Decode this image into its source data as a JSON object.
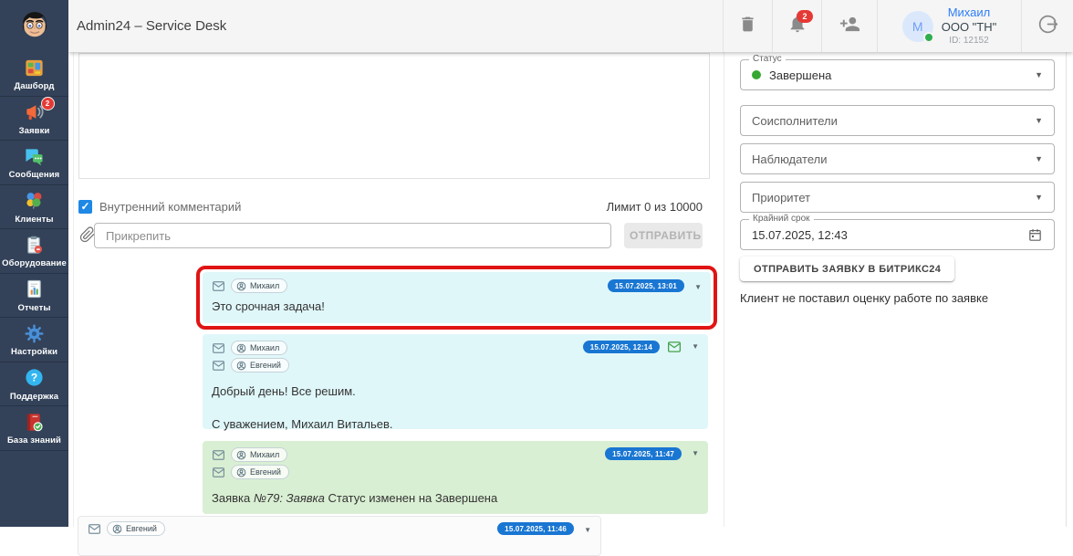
{
  "header": {
    "title": "Admin24 – Service Desk",
    "notifications_badge": "2",
    "user": {
      "name": "Михаил",
      "company": "ООО \"ТН\"",
      "id_label": "ID: 12152",
      "avatar_initial": "M"
    }
  },
  "sidebar": {
    "items": [
      {
        "label": "Дашборд"
      },
      {
        "label": "Заявки",
        "badge": "2"
      },
      {
        "label": "Сообщения"
      },
      {
        "label": "Клиенты"
      },
      {
        "label": "Оборудование"
      },
      {
        "label": "Отчеты"
      },
      {
        "label": "Настройки"
      },
      {
        "label": "Поддержка"
      },
      {
        "label": "База знаний"
      }
    ]
  },
  "composer": {
    "internal_comment_label": "Внутренний комментарий",
    "limit_label": "Лимит 0 из 10000",
    "attach_placeholder": "Прикрепить",
    "send_label": "ОТПРАВИТЬ"
  },
  "messages": [
    {
      "participants": [
        "Михаил"
      ],
      "timestamp": "15.07.2025, 13:01",
      "lines": [
        "Это срочная задача!"
      ],
      "highlighted": true
    },
    {
      "participants": [
        "Михаил",
        "Евгений"
      ],
      "timestamp": "15.07.2025, 12:14",
      "email_sent": true,
      "lines": [
        "Добрый день! Все решим.",
        "С уважением, Михаил Витальев."
      ]
    },
    {
      "participants": [
        "Михаил",
        "Евгений"
      ],
      "timestamp": "15.07.2025, 11:47",
      "text_plain": "Заявка ",
      "text_italic": "№79: Заявка ",
      "text_rest": "Статус изменен на Завершена"
    },
    {
      "participants": [
        "Евгений"
      ],
      "timestamp": "15.07.2025, 11:46"
    }
  ],
  "panel": {
    "status": {
      "label": "Статус",
      "value": "Завершена"
    },
    "fields": [
      {
        "placeholder": "Соисполнители"
      },
      {
        "placeholder": "Наблюдатели"
      },
      {
        "placeholder": "Приоритет"
      }
    ],
    "deadline": {
      "label": "Крайний срок",
      "value": "15.07.2025, 12:43"
    },
    "bitrix_button": "ОТПРАВИТЬ ЗАЯВКУ В БИТРИКС24",
    "rating_note": "Клиент не поставил оценку работе по заявке"
  },
  "colors": {
    "sidebar-bg": "#334259",
    "header-bg": "#f5f5f5",
    "accent-blue": "#1976d2",
    "link-blue": "#2e7ef7",
    "bubble-cyan": "#e0f7fa",
    "bubble-green": "#d9efd3",
    "badge-red": "#e53935",
    "status-green": "#36a832",
    "highlight-red": "#e01414"
  }
}
